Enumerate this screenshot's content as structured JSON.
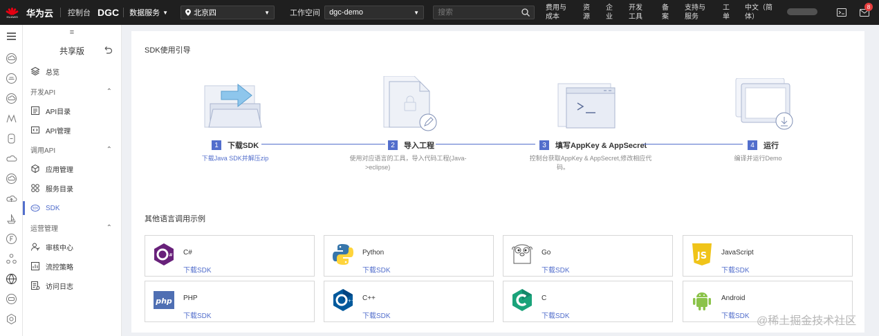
{
  "topbar": {
    "logo_text": "HUAWEI",
    "brand": "华为云",
    "console": "控制台",
    "product": "DGC",
    "service": "数据服务",
    "region": "北京四",
    "workspace_label": "工作空间",
    "workspace": "dgc-demo",
    "search_placeholder": "搜索",
    "menu": [
      {
        "line1": "费用与",
        "line2": "成本"
      },
      {
        "line1": "资",
        "line2": "源"
      },
      {
        "line1": "企",
        "line2": "业"
      },
      {
        "line1": "开发",
        "line2": "工具"
      },
      {
        "line1": "备",
        "line2": "案"
      },
      {
        "line1": "支持与",
        "line2": "服务"
      },
      {
        "line1": "工",
        "line2": "单"
      },
      {
        "line1": "中文（简",
        "line2": "体）"
      }
    ],
    "notification_count": "8"
  },
  "sidebar": {
    "collapse": "≡",
    "title": "共享版",
    "overview": "总览",
    "group_dev": "开发API",
    "api_catalog": "API目录",
    "api_manage": "API管理",
    "group_call": "调用API",
    "app_manage": "应用管理",
    "service_catalog": "服务目录",
    "sdk": "SDK",
    "group_ops": "运营管理",
    "audit": "审核中心",
    "flow_policy": "流控策略",
    "access_log": "访问日志"
  },
  "guide": {
    "title": "SDK使用引导",
    "steps": [
      {
        "num": "1",
        "label": "下载SDK",
        "desc": "下载Java SDK并解压zip"
      },
      {
        "num": "2",
        "label": "导入工程",
        "desc": "使用对应语言的工具，导入代码工程(Java-",
        "desc2": ">eclipse)"
      },
      {
        "num": "3",
        "label": "填写AppKey & AppSecret",
        "desc": "控制台获取AppKey & AppSecret,修改相应代",
        "desc2": "码。"
      },
      {
        "num": "4",
        "label": "运行",
        "desc": "编译并运行Demo"
      }
    ]
  },
  "examples": {
    "title": "其他语言调用示例",
    "download": "下载SDK",
    "items": [
      {
        "name": "C#"
      },
      {
        "name": "Python"
      },
      {
        "name": "Go"
      },
      {
        "name": "JavaScript"
      },
      {
        "name": "PHP"
      },
      {
        "name": "C++"
      },
      {
        "name": "C"
      },
      {
        "name": "Android"
      }
    ]
  },
  "watermark": "@稀土掘金技术社区",
  "colors": {
    "accent": "#526ecc",
    "topbar": "#1f1f1f",
    "brand_red": "#e60012"
  }
}
